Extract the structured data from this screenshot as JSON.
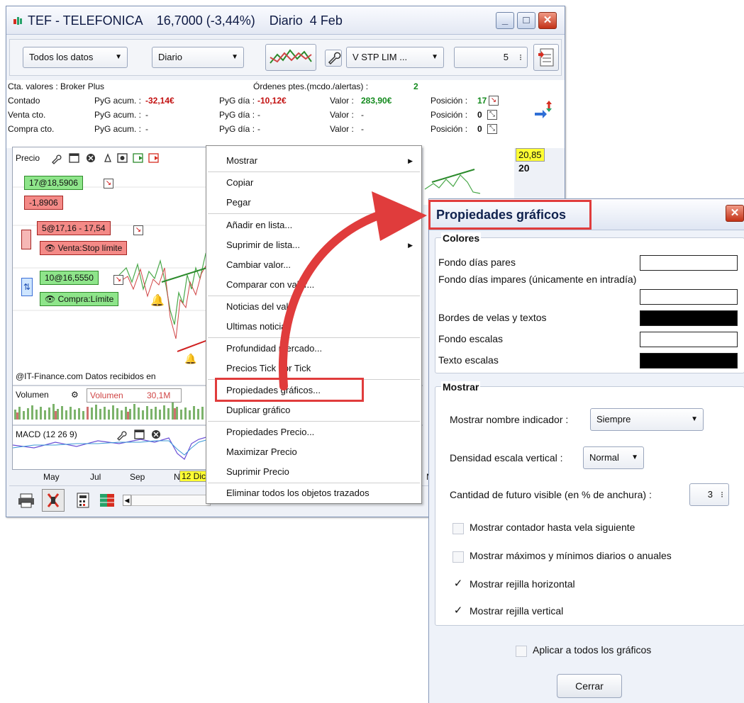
{
  "window": {
    "title": "TEF - TELEFONICA    16,7000 (-3,44%)    Diario  4 Feb",
    "controls": {
      "minimize": "_",
      "maximize": "□",
      "close": "✕"
    }
  },
  "toolbar": {
    "data_range": "Todos los datos",
    "period": "Diario",
    "order_type": "V STP LIM ...",
    "quantity": "5"
  },
  "account": {
    "account_line": "Cta. valores : Broker Plus",
    "orders_label": "Órdenes ptes.(mcdo./alertas) :",
    "orders_count": "2",
    "rows": [
      {
        "name": "Contado",
        "pyg_acum_label": "PyG acum. :",
        "pyg_acum": "-32,14€",
        "pyg_dia_label": "PyG día :",
        "pyg_dia": "-10,12€",
        "valor_label": "Valor :",
        "valor": "283,90€",
        "posicion_label": "Posición :",
        "posicion": "17"
      },
      {
        "name": "Venta cto.",
        "pyg_acum_label": "PyG acum. :",
        "pyg_acum": "-",
        "pyg_dia_label": "PyG día :",
        "pyg_dia": "-",
        "valor_label": "Valor :",
        "valor": "-",
        "posicion_label": "Posición :",
        "posicion": "0"
      },
      {
        "name": "Compra cto.",
        "pyg_acum_label": "PyG acum. :",
        "pyg_acum": "-",
        "pyg_dia_label": "PyG día :",
        "pyg_dia": "-",
        "valor_label": "Valor :",
        "valor": "-",
        "posicion_label": "Posición :",
        "posicion": "0"
      }
    ]
  },
  "chart": {
    "price_panel_label": "Precio",
    "price_level_tag": "20,85",
    "price_axis_tick": "20",
    "position_tag": "17@18,5906",
    "position_pnl": "-1,8906",
    "sell_order_tag": "5@17,16 - 17,54",
    "sell_order_type": "Venta:Stop límite",
    "buy_order_tag": "10@16,5550",
    "buy_order_type": "Compra:Límite",
    "credits": "@IT-Finance.com  Datos recibidos en",
    "volume_label": "Volumen",
    "volume_series": "Volumen",
    "volume_value": "30,1M",
    "macd_label": "MACD (12 26 9)",
    "x_ticks": [
      "May",
      "Jul",
      "Sep",
      "N"
    ],
    "x_cursor": "12 Dic",
    "x_end": "No"
  },
  "context_menu": {
    "items": [
      {
        "label": "Mostrar",
        "submenu": true
      },
      {
        "label": "Copiar"
      },
      {
        "label": "Pegar"
      },
      {
        "label": "Añadir en lista..."
      },
      {
        "label": "Suprimir de lista...",
        "submenu": true
      },
      {
        "label": "Cambiar valor..."
      },
      {
        "label": "Comparar con valor..."
      },
      {
        "label": "Noticias del valor"
      },
      {
        "label": "Ultimas noticias"
      },
      {
        "label": "Profundidad mercado..."
      },
      {
        "label": "Precios Tick por Tick"
      },
      {
        "label": "Propiedades gráficos..."
      },
      {
        "label": "Duplicar gráfico"
      },
      {
        "label": "Propiedades Precio..."
      },
      {
        "label": "Maximizar Precio"
      },
      {
        "label": "Suprimir Precio"
      },
      {
        "label": "Eliminar todos los objetos trazados"
      }
    ]
  },
  "dialog": {
    "title": "Propiedades gráficos",
    "colors_section": "Colores",
    "color_rows": [
      {
        "label": "Fondo días pares",
        "color": "#ffffff"
      },
      {
        "label": "Fondo días impares (únicamente en intradía)",
        "color": "#ffffff"
      },
      {
        "label": "Bordes de velas y textos",
        "color": "#000000"
      },
      {
        "label": "Fondo escalas",
        "color": "#ffffff"
      },
      {
        "label": "Texto escalas",
        "color": "#000000"
      }
    ],
    "show_section": "Mostrar",
    "indicator_name_label": "Mostrar nombre indicador :",
    "indicator_name_value": "Siempre",
    "density_label": "Densidad escala vertical :",
    "density_value": "Normal",
    "future_label": "Cantidad de futuro visible (en % de anchura) :",
    "future_value": "3",
    "checkboxes": [
      {
        "label": "Mostrar contador hasta vela siguiente",
        "checked": false
      },
      {
        "label": "Mostrar máximos y mínimos diarios o anuales",
        "checked": false
      },
      {
        "label": "Mostrar rejilla horizontal",
        "checked": true
      },
      {
        "label": "Mostrar rejilla vertical",
        "checked": true
      }
    ],
    "apply_all_label": "Aplicar a todos los gráficos",
    "apply_all_checked": false,
    "close_button": "Cerrar"
  },
  "colors": {
    "highlight": "#e03c3c",
    "positive": "#138a1d",
    "negative": "#c21010",
    "tag_green": "#8ee58a",
    "tag_red": "#f48a87"
  }
}
